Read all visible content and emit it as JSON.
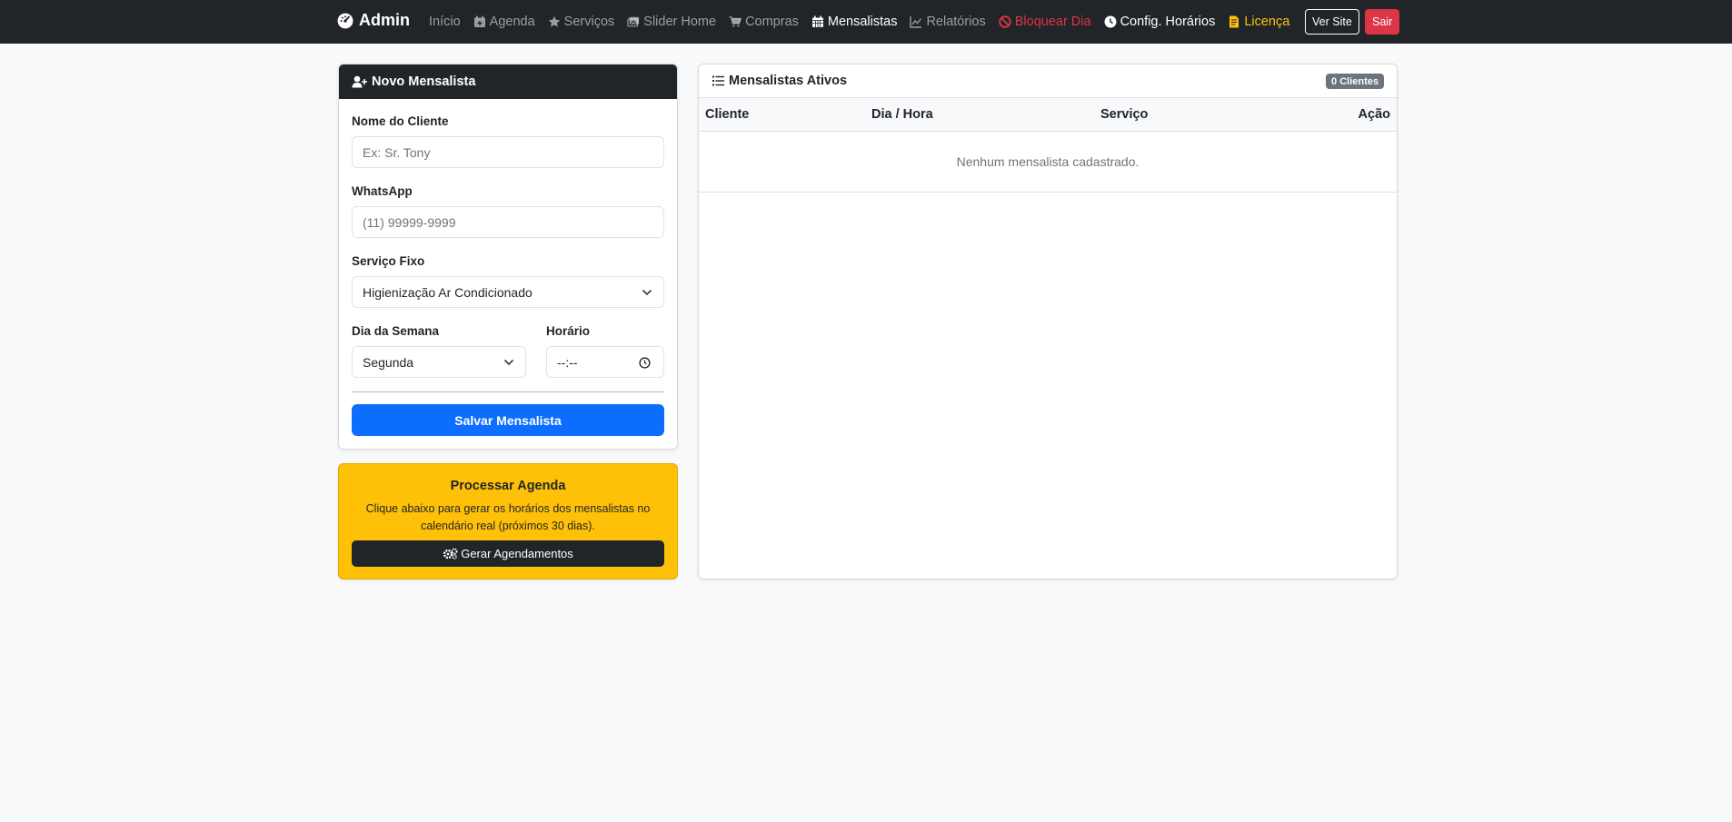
{
  "navbar": {
    "brand": "Admin",
    "links": [
      {
        "label": "Início"
      },
      {
        "label": "Agenda"
      },
      {
        "label": "Serviços"
      },
      {
        "label": "Slider Home"
      },
      {
        "label": "Compras"
      },
      {
        "label": "Mensalistas"
      },
      {
        "label": "Relatórios"
      },
      {
        "label": "Bloquear Dia"
      },
      {
        "label": "Config. Horários"
      },
      {
        "label": "Licença"
      }
    ],
    "view_site": "Ver Site",
    "logout": "Sair"
  },
  "form": {
    "title": "Novo Mensalista",
    "name_label": "Nome do Cliente",
    "name_placeholder": "Ex: Sr. Tony",
    "whatsapp_label": "WhatsApp",
    "whatsapp_placeholder": "(11) 99999-9999",
    "service_label": "Serviço Fixo",
    "service_value": "Higienização Ar Condicionado",
    "weekday_label": "Dia da Semana",
    "weekday_value": "Segunda",
    "time_label": "Horário",
    "time_value": "--:--",
    "save_button": "Salvar Mensalista"
  },
  "process": {
    "title": "Processar Agenda",
    "text": "Clique abaixo para gerar os horários dos mensalistas no calendário real (próximos 30 dias).",
    "button": "Gerar Agendamentos"
  },
  "list": {
    "title": "Mensalistas Ativos",
    "badge": "0 Clientes",
    "columns": [
      "Cliente",
      "Dia / Hora",
      "Serviço",
      "Ação"
    ],
    "empty": "Nenhum mensalista cadastrado."
  },
  "colors": {
    "navbar": "#212529",
    "primary": "#0d6efd",
    "warning": "#ffc107",
    "danger": "#dc3545"
  }
}
